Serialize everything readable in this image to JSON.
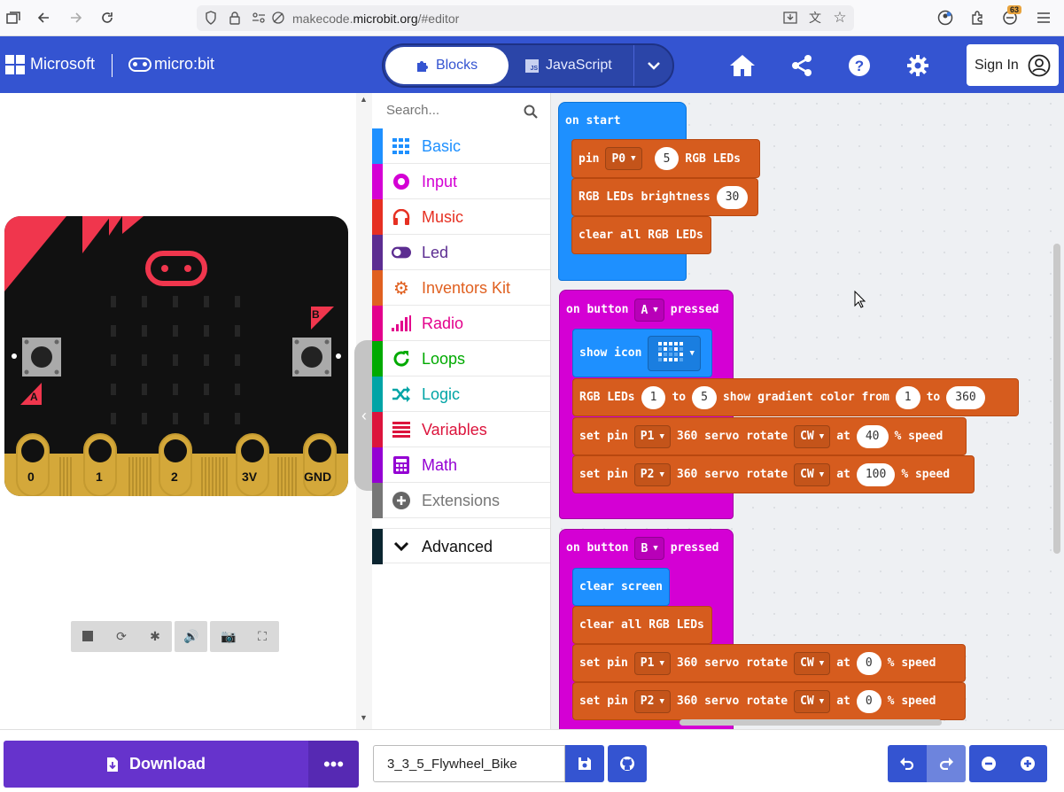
{
  "browser": {
    "url_prefix": "makecode.",
    "url_domain": "microbit.org",
    "url_suffix": "/#editor",
    "extension_badge": "63"
  },
  "header": {
    "brand": "Microsoft",
    "product": "micro:bit",
    "tab_blocks": "Blocks",
    "tab_js": "JavaScript",
    "signin": "Sign In"
  },
  "simulator": {
    "button_a": "A",
    "button_b": "B",
    "pins": [
      "0",
      "1",
      "2",
      "3V",
      "GND"
    ]
  },
  "toolbox": {
    "search_placeholder": "Search...",
    "categories": [
      {
        "label": "Basic",
        "color": "#1e90ff",
        "icon": "grid-icon"
      },
      {
        "label": "Input",
        "color": "#d400d4",
        "icon": "target-icon"
      },
      {
        "label": "Music",
        "color": "#e63022",
        "icon": "headphones-icon"
      },
      {
        "label": "Led",
        "color": "#5c2d91",
        "icon": "toggle-icon"
      },
      {
        "label": "Inventors Kit",
        "color": "#e06020",
        "icon": "gear-icon"
      },
      {
        "label": "Radio",
        "color": "#e3008c",
        "icon": "signal-icon"
      },
      {
        "label": "Loops",
        "color": "#00aa00",
        "icon": "refresh-icon"
      },
      {
        "label": "Logic",
        "color": "#00a4a6",
        "icon": "shuffle-icon"
      },
      {
        "label": "Variables",
        "color": "#dc143c",
        "icon": "list-icon"
      },
      {
        "label": "Math",
        "color": "#9400d3",
        "icon": "calculator-icon"
      },
      {
        "label": "Extensions",
        "color": "#777777",
        "icon": "plus-circle-icon"
      }
    ],
    "advanced": "Advanced"
  },
  "workspace": {
    "on_start": {
      "hat": "on start",
      "pin_label": "pin",
      "pin_value": "P0",
      "pin_count": "5",
      "rgb_leds": "RGB LEDs",
      "brightness_label": "RGB LEDs brightness",
      "brightness_value": "30",
      "clear_all": "clear all RGB LEDs"
    },
    "button_a": {
      "hat_prefix": "on button",
      "button": "A",
      "hat_suffix": "pressed",
      "show_icon": "show icon",
      "gradient_label": "RGB LEDs",
      "gradient_from_led": "1",
      "gradient_to_word": "to",
      "gradient_to_led": "5",
      "gradient_mid": "show gradient color from",
      "gradient_hue_from": "1",
      "gradient_hue_to": "360",
      "servo1_set": "set pin",
      "servo1_pin": "P1",
      "servo1_mid": "360 servo rotate",
      "servo1_dir": "CW",
      "servo1_at": "at",
      "servo1_speed": "40",
      "servo1_suffix": "% speed",
      "servo2_pin": "P2",
      "servo2_dir": "CW",
      "servo2_speed": "100"
    },
    "button_b": {
      "button": "B",
      "clear_screen": "clear screen",
      "clear_all": "clear all RGB LEDs",
      "servo1_pin": "P1",
      "servo1_dir": "CW",
      "servo1_speed": "0",
      "servo2_pin": "P2",
      "servo2_dir": "CW",
      "servo2_speed": "0"
    }
  },
  "bottom": {
    "download": "Download",
    "more": "•••",
    "project_name": "3_3_5_Flywheel_Bike"
  }
}
